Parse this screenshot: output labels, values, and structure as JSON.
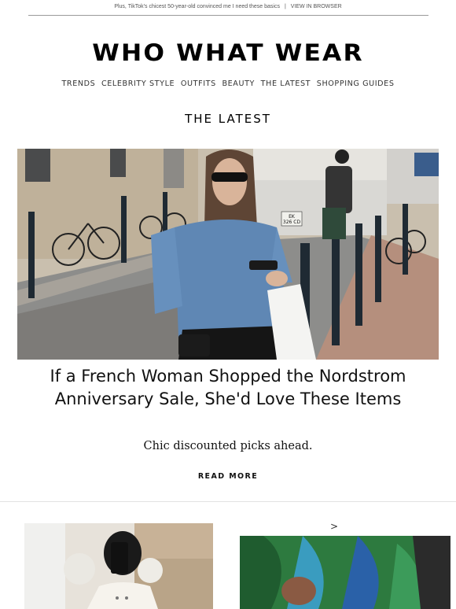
{
  "preheader": {
    "text": "Plus, TikTok's chicest 50-year-old convinced me I need these basics",
    "separator": "|",
    "link": "VIEW IN BROWSER"
  },
  "brand": {
    "logo": "WHO WHAT WEAR"
  },
  "nav": {
    "items": [
      "TRENDS",
      "CELEBRITY STYLE",
      "OUTFITS",
      "BEAUTY",
      "THE LATEST",
      "SHOPPING GUIDES"
    ]
  },
  "section": {
    "title": "THE LATEST"
  },
  "feature": {
    "headline": "If a French Woman Shopped the Nordstrom Anniversary Sale, She'd Love These Items",
    "dek": "Chic discounted picks ahead.",
    "cta": "READ MORE",
    "license_plate": "EK\n326 CD"
  },
  "more": {
    "chevron": ">"
  }
}
